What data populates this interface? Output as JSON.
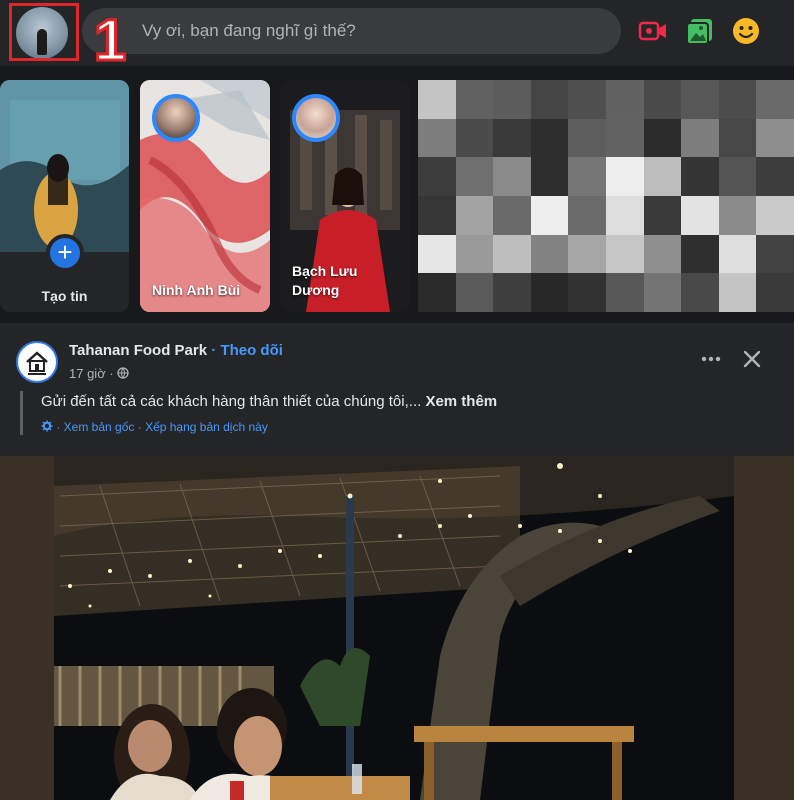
{
  "composer": {
    "placeholder": "Vy ơi, bạn đang nghĩ gì thế?",
    "step_number": "1",
    "tools": [
      "live-video-icon",
      "photo-video-icon",
      "feeling-emoji-icon"
    ]
  },
  "stories": {
    "create_label": "Tạo tin",
    "items": [
      {
        "name": "Ninh Anh Bùi"
      },
      {
        "name": "Bạch Lưu Dương"
      }
    ]
  },
  "post": {
    "page_name": "Tahanan Food Park",
    "separator": " · ",
    "follow_label": "Theo dõi",
    "time": "17 giờ",
    "audience_icon": "globe-icon",
    "text": "Gửi đến tất cả các khách hàng thân thiết của chúng tôi,...",
    "see_more": "Xem thêm",
    "view_original": "Xem bản gốc",
    "rate_translation": "Xếp hạng bản dịch này"
  },
  "colors": {
    "accent": "#2374e1",
    "link": "#4599ff",
    "highlight": "#e0252b",
    "background": "#18191a",
    "card": "#242526"
  }
}
